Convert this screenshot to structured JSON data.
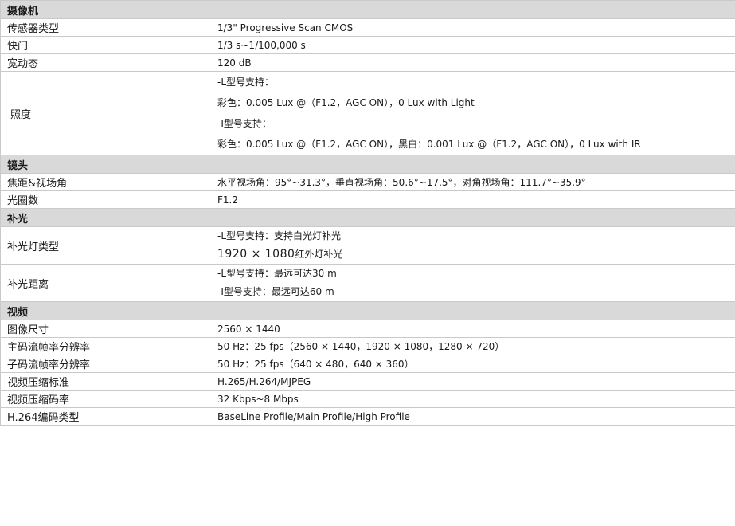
{
  "sections": {
    "camera": {
      "title": "摄像机",
      "sensor": {
        "label": "传感器类型",
        "value": "1/3\" Progressive Scan CMOS"
      },
      "shutter": {
        "label": "快门",
        "value": "1/3 s~1/100,000 s"
      },
      "wdr": {
        "label": "宽动态",
        "value": "120 dB"
      },
      "illumination": {
        "label": "照度",
        "lines": [
          "-L型号支持：",
          "彩色：0.005 Lux @（F1.2，AGC ON），0 Lux with Light",
          "-I型号支持：",
          "彩色：0.005 Lux @（F1.2，AGC ON），黑白：0.001 Lux @（F1.2，AGC ON），0 Lux with IR"
        ]
      }
    },
    "lens": {
      "title": "镜头",
      "fov": {
        "label": "焦距&视场角",
        "value": "水平视场角：95°~31.3°，垂直视场角：50.6°~17.5°，对角视场角：111.7°~35.9°"
      },
      "aperture": {
        "label": "光圈数",
        "value": "F1.2"
      }
    },
    "supplement_light": {
      "title": "补光",
      "type": {
        "label": "补光灯类型",
        "line1": "-L型号支持：支持白光灯补光",
        "line2_res": "1920 × 1080",
        "line2_text": "红外灯补光"
      },
      "distance": {
        "label": "补光距离",
        "lines": [
          "-L型号支持：最远可达30 m",
          "-I型号支持：最远可达60 m"
        ]
      }
    },
    "video": {
      "title": "视频",
      "image_size": {
        "label": "图像尺寸",
        "value": "2560 × 1440"
      },
      "main_stream": {
        "label": "主码流帧率分辨率",
        "value": "50 Hz：25 fps（2560 × 1440，1920 × 1080，1280 × 720）"
      },
      "sub_stream": {
        "label": "子码流帧率分辨率",
        "value": "50 Hz：25 fps（640 × 480，640 × 360）"
      },
      "compression": {
        "label": "视频压缩标准",
        "value": "H.265/H.264/MJPEG"
      },
      "bitrate": {
        "label": "视频压缩码率",
        "value": "32 Kbps~8 Mbps"
      },
      "h264_profile": {
        "label": "H.264编码类型",
        "value": "BaseLine Profile/Main Profile/High Profile"
      }
    }
  }
}
